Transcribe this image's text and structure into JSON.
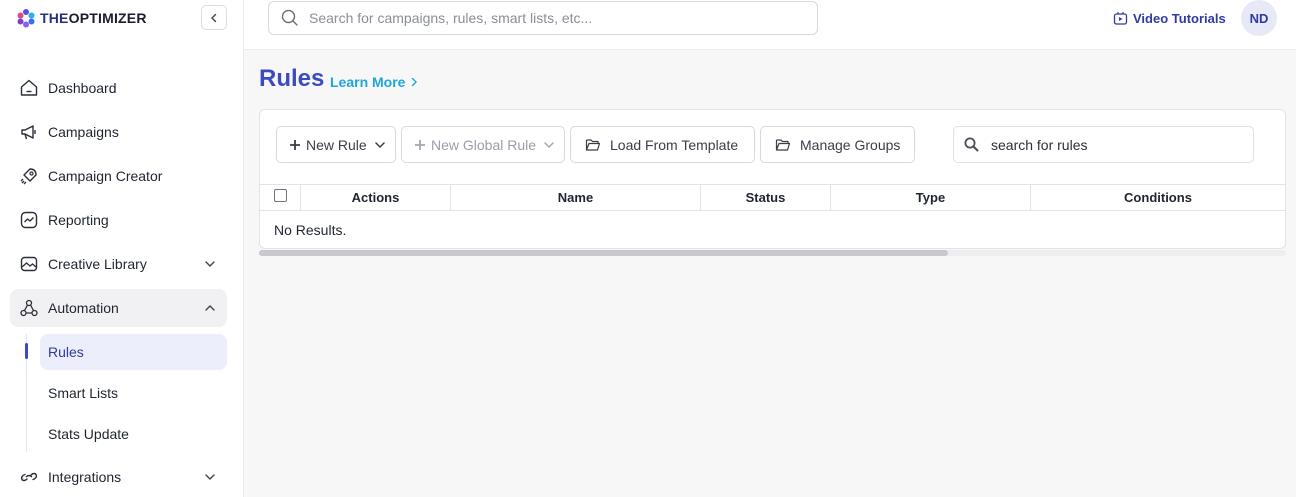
{
  "brand": {
    "name_prefix": "THE",
    "name_suffix": "OPTIMIZER"
  },
  "sidebar": {
    "items": [
      {
        "label": "Dashboard",
        "icon": "home-icon"
      },
      {
        "label": "Campaigns",
        "icon": "megaphone-icon"
      },
      {
        "label": "Campaign Creator",
        "icon": "rocket-icon"
      },
      {
        "label": "Reporting",
        "icon": "chart-line-icon"
      },
      {
        "label": "Creative Library",
        "icon": "image-icon"
      },
      {
        "label": "Automation",
        "icon": "automation-icon"
      },
      {
        "label": "Integrations",
        "icon": "link-icon"
      }
    ],
    "sub_items": [
      {
        "label": "Rules",
        "active": true
      },
      {
        "label": "Smart Lists"
      },
      {
        "label": "Stats Update"
      }
    ]
  },
  "topbar": {
    "search_placeholder": "Search for campaigns, rules, smart lists, etc...",
    "video_tutorials": "Video Tutorials",
    "avatar_initials": "ND"
  },
  "page": {
    "title": "Rules",
    "learn_more": "Learn More"
  },
  "toolbar": {
    "new_rule": "New Rule",
    "new_global_rule": "New Global Rule",
    "load_from_template": "Load From Template",
    "manage_groups": "Manage Groups",
    "search_value": "search for rules"
  },
  "table": {
    "columns": [
      "Actions",
      "Name",
      "Status",
      "Type",
      "Conditions"
    ],
    "empty_text": "No Results."
  },
  "colors": {
    "accent": "#3d4bbf",
    "link": "#1ea6d8"
  }
}
